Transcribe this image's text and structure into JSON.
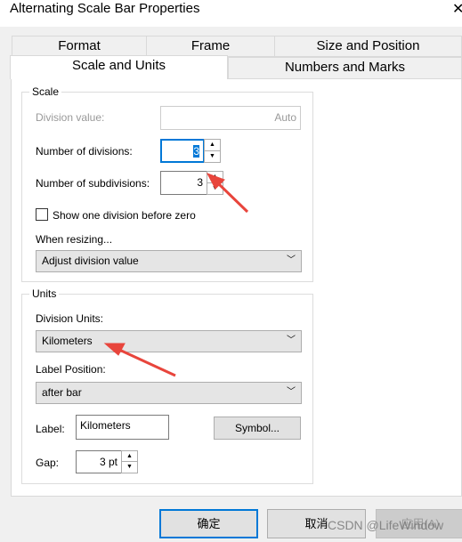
{
  "window": {
    "title": "Alternating Scale Bar Properties"
  },
  "tabs": {
    "row1": [
      "Format",
      "Frame",
      "Size and Position"
    ],
    "row2": [
      "Scale and Units",
      "Numbers and Marks"
    ],
    "active": "Scale and Units"
  },
  "scale": {
    "legend": "Scale",
    "division_value_label": "Division value:",
    "division_value": "Auto",
    "divisions_label": "Number of divisions:",
    "divisions": "3",
    "subdivisions_label": "Number of subdivisions:",
    "subdivisions": "3",
    "show_before_zero_label": "Show one division before zero",
    "show_before_zero": false,
    "resizing_label": "When resizing...",
    "resizing_value": "Adjust division value"
  },
  "units": {
    "legend": "Units",
    "division_units_label": "Division Units:",
    "division_units": "Kilometers",
    "label_position_label": "Label Position:",
    "label_position": "after bar",
    "label_label": "Label:",
    "label_value": "Kilometers",
    "symbol_button": "Symbol...",
    "gap_label": "Gap:",
    "gap_value": "3 pt"
  },
  "buttons": {
    "ok": "确定",
    "cancel": "取消",
    "apply": "应用(A)"
  },
  "watermark": "CSDN @LifeWindow",
  "colors": {
    "accent": "#0078d7",
    "annotation_arrow": "#e8453c"
  }
}
